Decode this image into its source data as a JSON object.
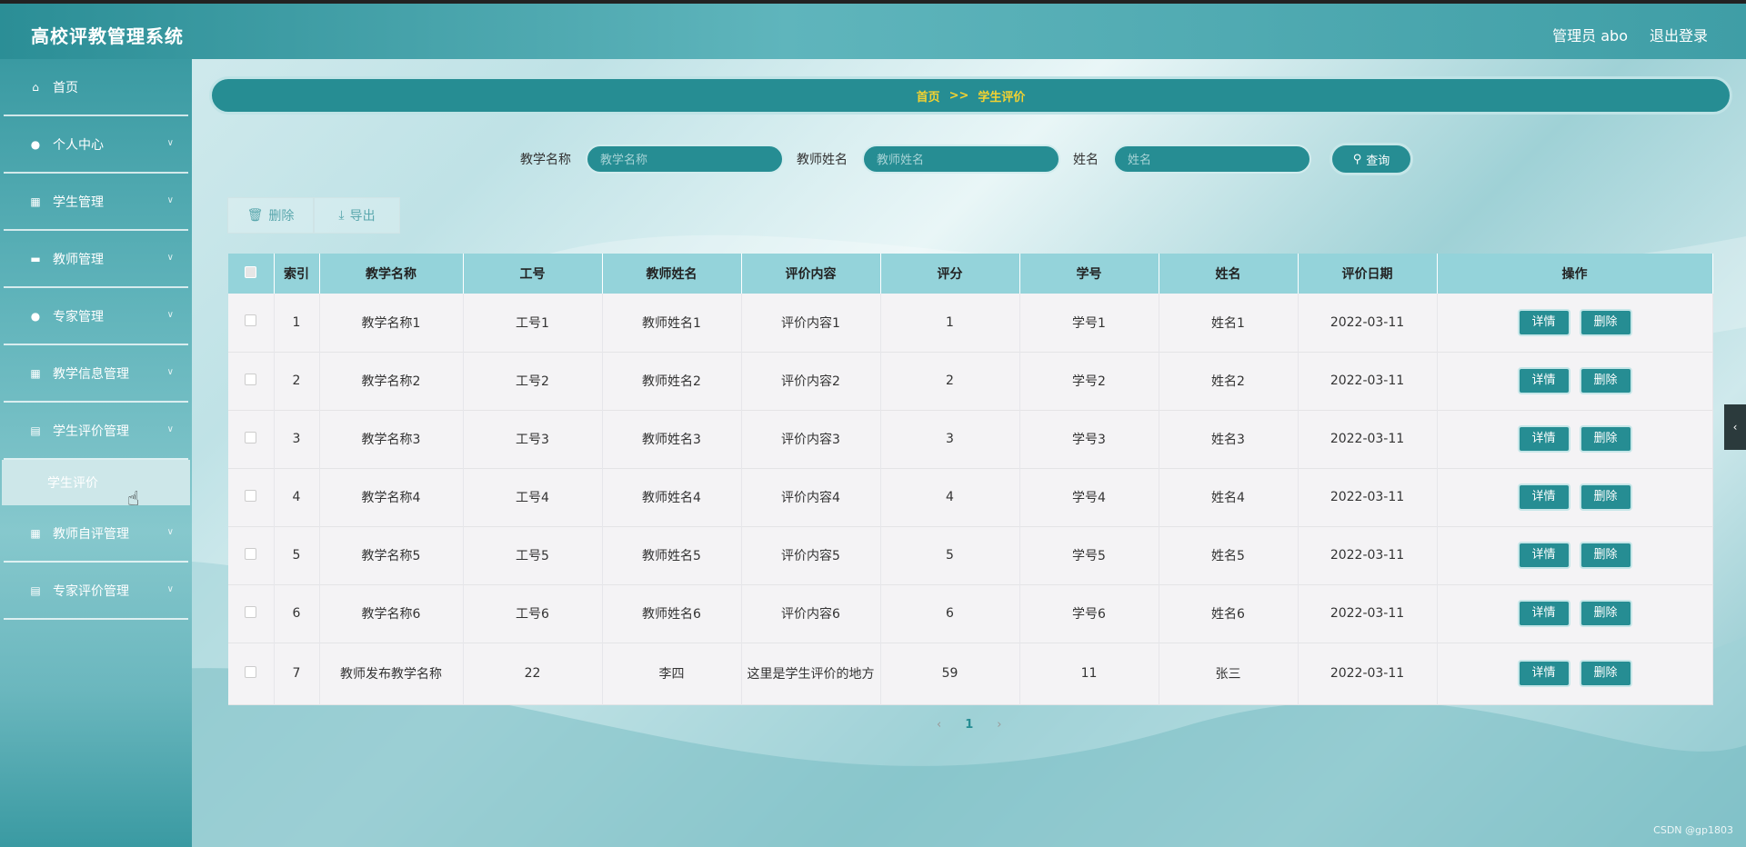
{
  "header": {
    "title": "高校评教管理系统",
    "user": "管理员 abo",
    "logout": "退出登录"
  },
  "sidebar": {
    "items": [
      {
        "label": "首页",
        "icon": "home-icon"
      },
      {
        "label": "个人中心",
        "icon": "user-icon"
      },
      {
        "label": "学生管理",
        "icon": "grid-icon"
      },
      {
        "label": "教师管理",
        "icon": "monitor-icon"
      },
      {
        "label": "专家管理",
        "icon": "user-icon"
      },
      {
        "label": "教学信息管理",
        "icon": "grid-icon"
      },
      {
        "label": "学生评价管理",
        "icon": "clipboard-icon"
      }
    ],
    "sub_item": "学生评价",
    "items_after": [
      {
        "label": "教师自评管理",
        "icon": "grid-icon"
      },
      {
        "label": "专家评价管理",
        "icon": "clipboard-icon"
      }
    ]
  },
  "breadcrumb": {
    "home": "首页",
    "sep": ">>",
    "current": "学生评价"
  },
  "search": {
    "label1": "教学名称",
    "placeholder1": "教学名称",
    "label2": "教师姓名",
    "placeholder2": "教师姓名",
    "label3": "姓名",
    "placeholder3": "姓名",
    "button": "查询"
  },
  "toolbar": {
    "delete": "删除",
    "export": "导出"
  },
  "table": {
    "headers": [
      "索引",
      "教学名称",
      "工号",
      "教师姓名",
      "评价内容",
      "评分",
      "学号",
      "姓名",
      "评价日期",
      "操作"
    ],
    "detail_label": "详情",
    "delete_label": "删除",
    "rows": [
      [
        "1",
        "教学名称1",
        "工号1",
        "教师姓名1",
        "评价内容1",
        "1",
        "学号1",
        "姓名1",
        "2022-03-11"
      ],
      [
        "2",
        "教学名称2",
        "工号2",
        "教师姓名2",
        "评价内容2",
        "2",
        "学号2",
        "姓名2",
        "2022-03-11"
      ],
      [
        "3",
        "教学名称3",
        "工号3",
        "教师姓名3",
        "评价内容3",
        "3",
        "学号3",
        "姓名3",
        "2022-03-11"
      ],
      [
        "4",
        "教学名称4",
        "工号4",
        "教师姓名4",
        "评价内容4",
        "4",
        "学号4",
        "姓名4",
        "2022-03-11"
      ],
      [
        "5",
        "教学名称5",
        "工号5",
        "教师姓名5",
        "评价内容5",
        "5",
        "学号5",
        "姓名5",
        "2022-03-11"
      ],
      [
        "6",
        "教学名称6",
        "工号6",
        "教师姓名6",
        "评价内容6",
        "6",
        "学号6",
        "姓名6",
        "2022-03-11"
      ],
      [
        "7",
        "教师发布教学名称",
        "22",
        "李四",
        "这里是学生评价的地方",
        "59",
        "11",
        "张三",
        "2022-03-11"
      ]
    ]
  },
  "pager": {
    "prev": "‹",
    "current": "1",
    "next": "›"
  },
  "watermark": "CSDN @gp1803",
  "colors": {
    "primary": "#268d93",
    "header_row": "#94d3da",
    "breadcrumb_text": "#f3d231"
  }
}
